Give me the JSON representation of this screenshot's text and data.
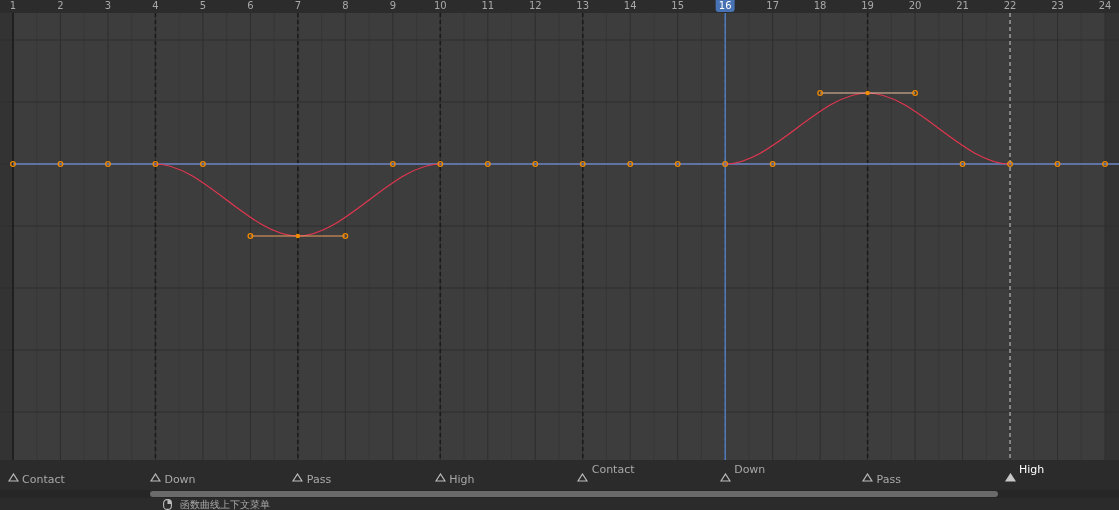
{
  "ruler": [
    {
      "label": "1",
      "selected": false
    },
    {
      "label": "2",
      "selected": false
    },
    {
      "label": "3",
      "selected": false
    },
    {
      "label": "4",
      "selected": false
    },
    {
      "label": "5",
      "selected": false
    },
    {
      "label": "6",
      "selected": false
    },
    {
      "label": "7",
      "selected": false
    },
    {
      "label": "8",
      "selected": false
    },
    {
      "label": "9",
      "selected": false
    },
    {
      "label": "10",
      "selected": false
    },
    {
      "label": "11",
      "selected": false
    },
    {
      "label": "12",
      "selected": false
    },
    {
      "label": "13",
      "selected": false
    },
    {
      "label": "14",
      "selected": false
    },
    {
      "label": "15",
      "selected": false
    },
    {
      "label": "16",
      "selected": true
    },
    {
      "label": "17",
      "selected": false
    },
    {
      "label": "18",
      "selected": false
    },
    {
      "label": "19",
      "selected": false
    },
    {
      "label": "20",
      "selected": false
    },
    {
      "label": "21",
      "selected": false
    },
    {
      "label": "22",
      "selected": false
    },
    {
      "label": "23",
      "selected": false
    },
    {
      "label": "24",
      "selected": false
    }
  ],
  "markers": [
    {
      "label": "Contact",
      "selected": false,
      "raised": false
    },
    {
      "label": "Down",
      "selected": false,
      "raised": false
    },
    {
      "label": "Pass",
      "selected": false,
      "raised": false
    },
    {
      "label": "High",
      "selected": false,
      "raised": false
    },
    {
      "label": "Contact",
      "selected": false,
      "raised": true
    },
    {
      "label": "Down",
      "selected": false,
      "raised": true
    },
    {
      "label": "Pass",
      "selected": false,
      "raised": false
    },
    {
      "label": "High",
      "selected": true,
      "raised": true
    }
  ],
  "status_bar": {
    "hint": "函数曲线上下文菜单"
  }
}
